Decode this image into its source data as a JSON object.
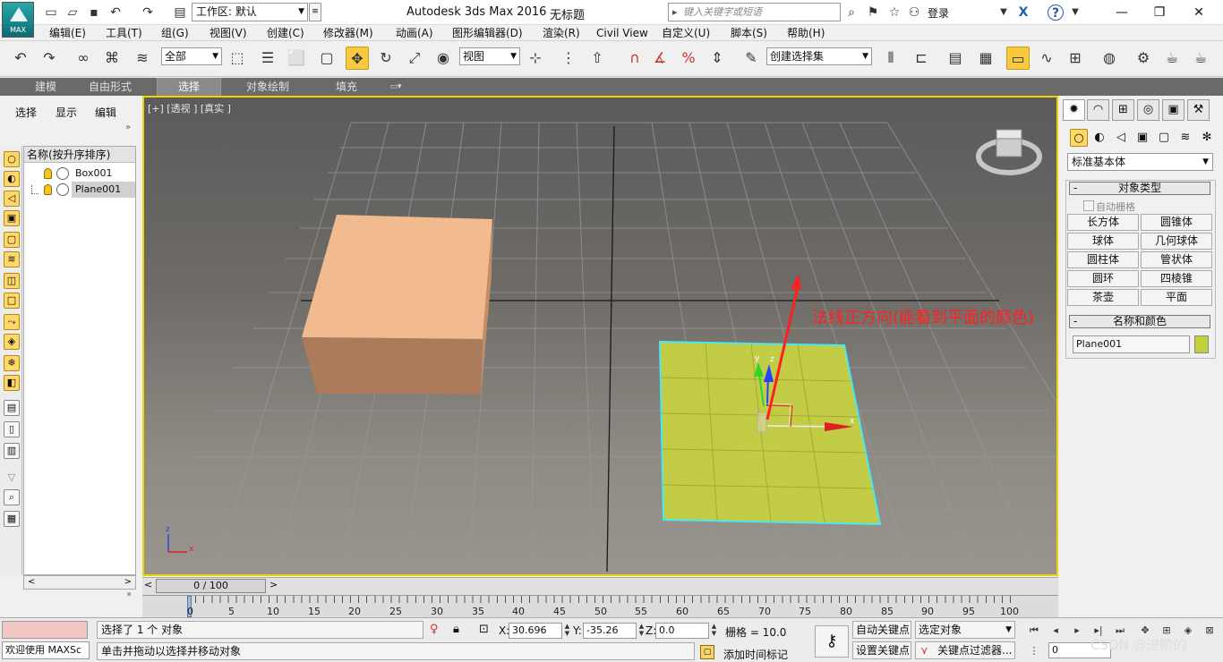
{
  "titlebar": {
    "workspace": "工作区: 默认",
    "app_title": "Autodesk 3ds Max 2016",
    "doc_title": "无标题",
    "search_placeholder": "键入关键字或短语",
    "login": "登录",
    "logo_text": "MAX"
  },
  "menubar": [
    "编辑(E)",
    "工具(T)",
    "组(G)",
    "视图(V)",
    "创建(C)",
    "修改器(M)",
    "动画(A)",
    "图形编辑器(D)",
    "渲染(R)",
    "Civil View",
    "自定义(U)",
    "脚本(S)",
    "帮助(H)"
  ],
  "toolbar": {
    "selection_filter": "全部",
    "ref_coord": "视图",
    "named_selection": "创建选择集"
  },
  "ribbon": {
    "tabs": [
      "建模",
      "自由形式",
      "选择",
      "对象绘制",
      "填充"
    ],
    "active": "选择"
  },
  "left_panel": {
    "tabs": [
      "选择",
      "显示",
      "编辑"
    ],
    "list_header": "名称(按升序排序)",
    "items": [
      "Box001",
      "Plane001"
    ],
    "selected": "Plane001"
  },
  "viewport": {
    "label": "[+] [透视 ] [真实 ]",
    "annotation": "法线正方向(能看到平面的颜色)",
    "gizmo": {
      "y": "y",
      "z": "z",
      "x": "x"
    },
    "mini_axis": {
      "z": "z",
      "x": "x"
    },
    "colors": {
      "box": "#f2bb8f",
      "plane": "#c2cd45",
      "selection": "#48e8f5",
      "annotation": "#ff2020",
      "border": "#f2d200"
    }
  },
  "right_panel": {
    "category": "标准基本体",
    "object_type_header": "对象类型",
    "autogrid": "自动栅格",
    "buttons": [
      "长方体",
      "圆锥体",
      "球体",
      "几何球体",
      "圆柱体",
      "管状体",
      "圆环",
      "四棱锥",
      "茶壶",
      "平面"
    ],
    "name_color_header": "名称和颜色",
    "object_name": "Plane001",
    "object_color": "#c3d13a"
  },
  "timeline": {
    "frame": "0 / 100",
    "ticks": [
      "0",
      "5",
      "10",
      "15",
      "20",
      "25",
      "30",
      "35",
      "40",
      "45",
      "50",
      "55",
      "60",
      "65",
      "70",
      "75",
      "80",
      "85",
      "90",
      "95",
      "100"
    ]
  },
  "status": {
    "welcome": "欢迎使用 MAXSc",
    "selected_msg": "选择了 1 个 对象",
    "prompt": "单击并拖动以选择并移动对象",
    "x_label": "X:",
    "x_val": "30.696",
    "y_label": "Y:",
    "y_val": "-35.26",
    "z_label": "Z:",
    "z_val": "0.0",
    "grid": "栅格 = 10.0",
    "auto_key": "自动关键点",
    "set_key": "设置关键点",
    "selected_obj": "选定对象",
    "key_filters": "关键点过滤器...",
    "add_time_tag": "添加时间标记",
    "frame_input": "0"
  },
  "watermark": "CSDN @进阶的"
}
